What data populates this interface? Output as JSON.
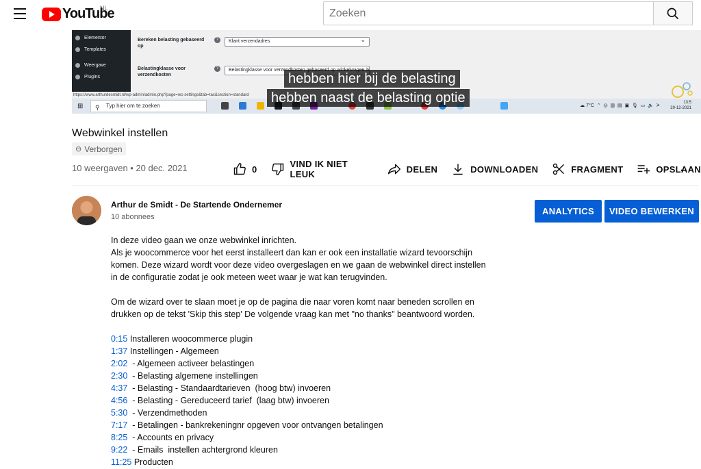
{
  "header": {
    "logo_text": "YouTube",
    "country_code": "NL",
    "search_placeholder": "Zoeken"
  },
  "video": {
    "wp_sidebar": [
      "Elementor",
      "Templates",
      "Weergave",
      "Plugins"
    ],
    "wp_fields": [
      {
        "label": "Bereken belasting gebaseerd op",
        "value": "Klant verzendadres"
      },
      {
        "label": "Belastingklasse voor verzendkosten",
        "value": "Belastingklasse voor verzendkosten gebaseerd op winkelwagen items"
      }
    ],
    "status_url": "https://www.arthurdesmidt.nl/wp-admin/admin.php?page=wc-settings&tab=tax&section=standard",
    "taskbar_search": "Typ hier om te zoeken",
    "weather": "7°C",
    "clock_time": "13:5",
    "clock_date": "20-12-2021",
    "captions": [
      "hebben hier bij de belasting",
      "hebben naast de belasting optie"
    ]
  },
  "title": "Webwinkel instellen",
  "visibility_badge": "Verborgen",
  "meta": "10 weergaven • 20 dec. 2021",
  "actions": {
    "like_count": "0",
    "dislike": "VIND IK NIET LEUK",
    "share": "DELEN",
    "download": "DOWNLOADEN",
    "clip": "FRAGMENT",
    "save": "OPSLAAN",
    "more": "..."
  },
  "channel": {
    "name": "Arthur de Smidt - De Startende Ondernemer",
    "subscribers": "10 abonnees",
    "analytics_button": "ANALYTICS",
    "edit_button": "VIDEO BEWERKEN"
  },
  "description": {
    "para1": "In deze video gaan we onze webwinkel inrichten.\nAls je woocommerce voor het eerst installeert dan kan er ook een installatie wizard tevoorschijn\nkomen. Deze wizard wordt voor deze video overgeslagen en we gaan de webwinkel direct instellen\nin de configuratie zodat je ook meteen weet waar je wat kan terugvinden.",
    "para2": "Om de wizard over te slaan moet je op de pagina die naar voren komt naar beneden scrollen en\ndrukken op de tekst 'Skip this step'  De volgende vraag kan met \"no thanks\" beantwoord worden.",
    "chapters": [
      {
        "time": "0:15",
        "text": " Installeren woocommerce plugin"
      },
      {
        "time": "1:37",
        "text": " Instellingen - Algemeen"
      },
      {
        "time": "2:02",
        "text": "  - Algemeen activeer belastingen"
      },
      {
        "time": "2:30",
        "text": "  - Belasting algemene instellingen"
      },
      {
        "time": "4:37",
        "text": "  - Belasting - Standaardtarieven  (hoog btw) invoeren"
      },
      {
        "time": "4:56",
        "text": "  - Belasting - Gereduceerd tarief  (laag btw) invoeren"
      },
      {
        "time": "5:30",
        "text": "  - Verzendmethoden"
      },
      {
        "time": "7:17",
        "text": "  - Betalingen - bankrekeningnr opgeven voor ontvangen betalingen"
      },
      {
        "time": "8:25",
        "text": "  - Accounts en privacy"
      },
      {
        "time": "9:22",
        "text": "  - Emails  instellen achtergrond kleuren"
      },
      {
        "time": "11:25",
        "text": " Producten"
      }
    ]
  }
}
